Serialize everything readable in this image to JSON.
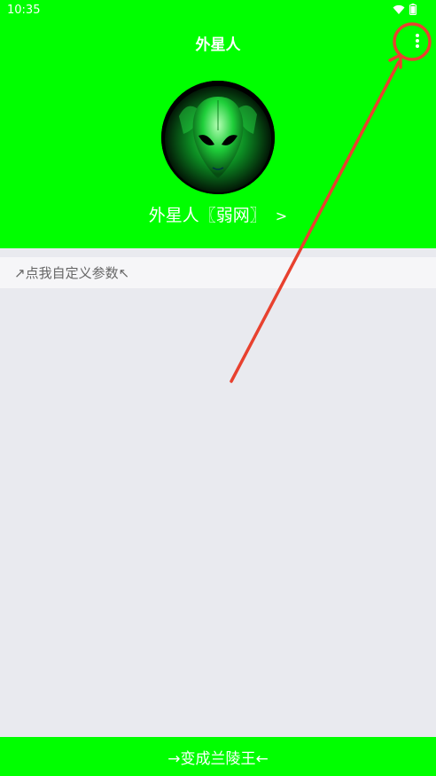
{
  "status_bar": {
    "time": "10:35"
  },
  "header": {
    "title": "外星人",
    "profile_name": "外星人〖弱网〗",
    "profile_chevron": ">"
  },
  "main": {
    "custom_params_label": "↗点我自定义参数↖"
  },
  "footer": {
    "action_label": "→变成兰陵王←"
  },
  "colors": {
    "header_bg": "#00ff00",
    "content_bg": "#e9eaef",
    "annotation": "#e8412f"
  },
  "icons": [
    "wifi-icon",
    "battery-icon",
    "more-vert-icon",
    "alien-avatar-image",
    "chevron-right-icon"
  ]
}
